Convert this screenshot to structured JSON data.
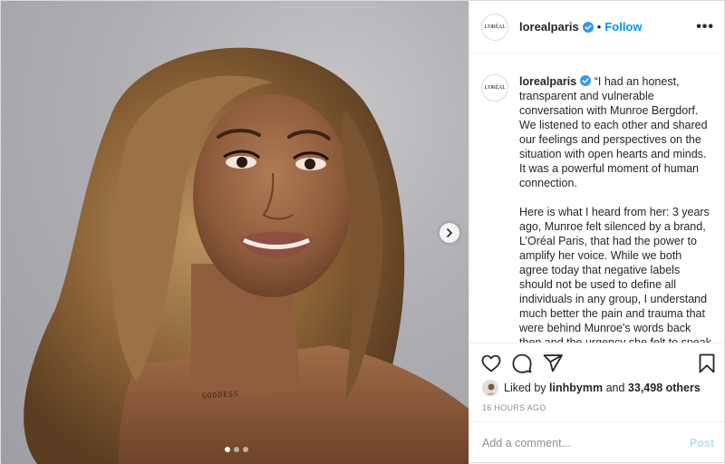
{
  "post": {
    "account": {
      "username": "lorealparis",
      "avatar_text": "L'ORÉAL",
      "verified": true,
      "follow_label": "Follow",
      "separator": "•"
    },
    "more_icon": "more-horizontal-icon",
    "caption": {
      "username": "lorealparis",
      "paragraphs": [
        "“I had an honest, transparent and vulnerable conversation with Munroe Bergdorf. We listened to each other and shared our feelings and perspectives on the situation with open hearts and minds. It was a powerful moment of human connection.",
        "Here is what I heard from her: 3 years ago, Munroe felt silenced by a brand, L’Oréal Paris, that had the power to amplify her voice. While we both agree today that negative labels should not be used to define all individuals in any group, I understand much better the pain and trauma that were behind Munroe's words back then and the urgency she felt to speak"
      ]
    },
    "media": {
      "tattoo_text": "GODDESS",
      "carousel_total": 3,
      "carousel_active": 1,
      "next_icon": "chevron-right-icon"
    },
    "actions": {
      "like_icon": "heart-icon",
      "comment_icon": "comment-icon",
      "share_icon": "share-icon",
      "save_icon": "bookmark-icon"
    },
    "likes": {
      "prefix": "Liked by",
      "user": "linhbymm",
      "connector": "and",
      "others": "33,498 others"
    },
    "timestamp": "16 HOURS AGO",
    "comment": {
      "placeholder": "Add a comment...",
      "post_label": "Post"
    },
    "colors": {
      "accent": "#0095f6",
      "post_disabled": "#b2dffc",
      "verified": "#3897f0"
    }
  }
}
